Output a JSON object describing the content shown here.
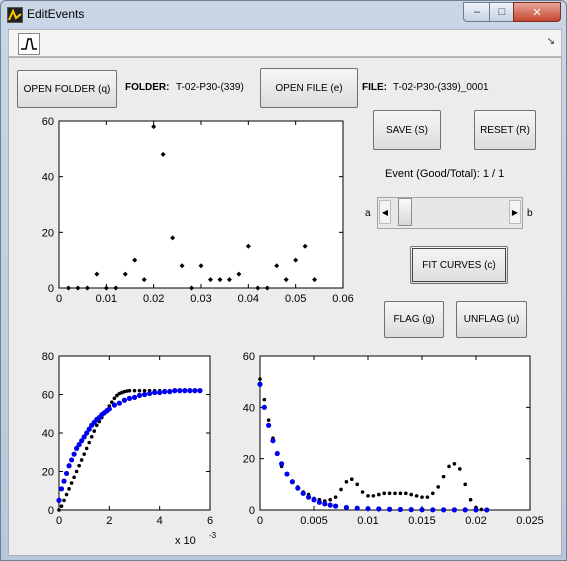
{
  "window": {
    "title": "EditEvents",
    "min_label": "–",
    "max_label": "□",
    "close_label": "✕"
  },
  "toolbar": {
    "corner_label": "↘"
  },
  "controls": {
    "open_folder_label": "OPEN FOLDER (q)",
    "folder_key": "FOLDER:",
    "folder_value": "T-02-P30-(339)",
    "open_file_label": "OPEN FILE (e)",
    "file_key": "FILE:",
    "file_value": "T-02-P30-(339)_0001",
    "save_label": "SAVE (S)",
    "reset_label": "RESET (R)",
    "event_label": "Event (Good/Total): 1 / 1",
    "slider_min_label": "a",
    "slider_max_label": "b",
    "slider_value": 0.05,
    "fit_label": "FIT CURVES (c)",
    "flag_label": "FLAG (g)",
    "unflag_label": "UNFLAG (u)"
  },
  "chart_data": [
    {
      "type": "scatter",
      "xlim": [
        0,
        0.06
      ],
      "ylim": [
        0,
        60
      ],
      "xticks": [
        "0",
        "0.01",
        "0.02",
        "0.03",
        "0.04",
        "0.05",
        "0.06"
      ],
      "yticks": [
        "0",
        "20",
        "40",
        "60"
      ],
      "marker_color": "#000000",
      "series": [
        {
          "x": [
            0.002,
            0.004,
            0.006,
            0.008,
            0.01,
            0.012,
            0.014,
            0.016,
            0.018,
            0.02,
            0.022,
            0.024,
            0.026,
            0.028,
            0.03,
            0.032,
            0.034,
            0.036,
            0.038,
            0.04,
            0.042,
            0.044,
            0.046,
            0.048,
            0.05,
            0.052,
            0.054
          ],
          "y": [
            0,
            0,
            0,
            5,
            0,
            0,
            5,
            10,
            3,
            58,
            48,
            18,
            8,
            0,
            8,
            3,
            3,
            3,
            5,
            15,
            0,
            0,
            8,
            3,
            10,
            15,
            3
          ]
        }
      ]
    },
    {
      "type": "scatter",
      "xlim": [
        0,
        0.006
      ],
      "ylim": [
        0,
        80
      ],
      "xticks": [
        "0",
        "2",
        "4",
        "6"
      ],
      "yticks": [
        "0",
        "20",
        "40",
        "60",
        "80"
      ],
      "x_multiplier": "x 10",
      "x_exponent": "-3",
      "series": [
        {
          "color": "#000000",
          "x": [
            0.0,
            0.0001,
            0.0002,
            0.0003,
            0.0004,
            0.0005,
            0.0006,
            0.0007,
            0.0008,
            0.0009,
            0.001,
            0.0011,
            0.0012,
            0.0013,
            0.0014,
            0.0015,
            0.0016,
            0.0017,
            0.0018,
            0.0019,
            0.002,
            0.0021,
            0.0022,
            0.0023,
            0.0024,
            0.0025,
            0.0026,
            0.0027,
            0.0028,
            0.003,
            0.0032,
            0.0034,
            0.0036,
            0.0038,
            0.004,
            0.0042,
            0.0044,
            0.0046,
            0.0048,
            0.005,
            0.0052,
            0.0054,
            0.0056
          ],
          "y": [
            0,
            2,
            5,
            8,
            11,
            14,
            17,
            20,
            23,
            26,
            29,
            32,
            35,
            38,
            41,
            44,
            46,
            48,
            50,
            52,
            54,
            56,
            58,
            59.5,
            60.5,
            61,
            61.5,
            61.8,
            62,
            62,
            62,
            62,
            62,
            62,
            62,
            62,
            62,
            62,
            62,
            62,
            62,
            62,
            62
          ]
        },
        {
          "color": "#0000ee",
          "x": [
            0.0,
            0.0001,
            0.0002,
            0.0003,
            0.0004,
            0.0005,
            0.0006,
            0.0007,
            0.0008,
            0.0009,
            0.001,
            0.0011,
            0.0012,
            0.0013,
            0.0014,
            0.0015,
            0.0016,
            0.0017,
            0.0018,
            0.0019,
            0.002,
            0.0022,
            0.0024,
            0.0026,
            0.0028,
            0.003,
            0.0032,
            0.0034,
            0.0036,
            0.0038,
            0.004,
            0.0042,
            0.0044,
            0.0046,
            0.0048,
            0.005,
            0.0052,
            0.0054,
            0.0056
          ],
          "y": [
            5,
            11,
            15,
            19,
            23,
            26,
            29,
            32,
            34,
            36,
            38,
            40,
            42,
            44,
            45.5,
            47,
            48,
            49.5,
            50.5,
            51.5,
            52.5,
            54.5,
            55.5,
            57,
            58,
            58.5,
            59.5,
            60,
            60.5,
            61,
            61,
            61.5,
            61.5,
            62,
            62,
            62,
            62,
            62,
            62
          ]
        }
      ]
    },
    {
      "type": "scatter",
      "xlim": [
        0,
        0.025
      ],
      "ylim": [
        0,
        60
      ],
      "xticks": [
        "0",
        "0.005",
        "0.01",
        "0.015",
        "0.02",
        "0.025"
      ],
      "yticks": [
        "0",
        "20",
        "40",
        "60"
      ],
      "series": [
        {
          "color": "#000000",
          "x": [
            0.0,
            0.0004,
            0.0008,
            0.0012,
            0.0016,
            0.002,
            0.0025,
            0.003,
            0.0035,
            0.004,
            0.0045,
            0.005,
            0.0055,
            0.006,
            0.0065,
            0.007,
            0.0075,
            0.008,
            0.0085,
            0.009,
            0.0095,
            0.01,
            0.0105,
            0.011,
            0.0115,
            0.012,
            0.0125,
            0.013,
            0.0135,
            0.014,
            0.0145,
            0.015,
            0.0155,
            0.016,
            0.0165,
            0.017,
            0.0175,
            0.018,
            0.0185,
            0.019,
            0.0195,
            0.02,
            0.0205,
            0.021
          ],
          "y": [
            51,
            43,
            35,
            28,
            22,
            17,
            14,
            11,
            9,
            7,
            6,
            4.5,
            4,
            3.5,
            4,
            5,
            8,
            11,
            12,
            10,
            7,
            5.5,
            5.5,
            6,
            6.5,
            6.5,
            6.5,
            6.5,
            6.5,
            6,
            5.5,
            5,
            5,
            6.5,
            9,
            13,
            17,
            18,
            16,
            10,
            4,
            1,
            0.2,
            0
          ]
        },
        {
          "color": "#0000ee",
          "x": [
            0.0,
            0.0004,
            0.0008,
            0.0012,
            0.0016,
            0.002,
            0.0025,
            0.003,
            0.0035,
            0.004,
            0.0045,
            0.005,
            0.0055,
            0.006,
            0.0065,
            0.007,
            0.008,
            0.009,
            0.01,
            0.011,
            0.012,
            0.013,
            0.014,
            0.015,
            0.016,
            0.017,
            0.018,
            0.019,
            0.02,
            0.021
          ],
          "y": [
            49,
            40,
            33,
            27,
            22,
            18,
            14,
            11,
            8.5,
            6.5,
            5,
            4,
            3,
            2.4,
            1.9,
            1.5,
            1,
            0.7,
            0.5,
            0.4,
            0.3,
            0.2,
            0.15,
            0.1,
            0.08,
            0.06,
            0.05,
            0.04,
            0.03,
            0.02
          ]
        }
      ]
    }
  ]
}
